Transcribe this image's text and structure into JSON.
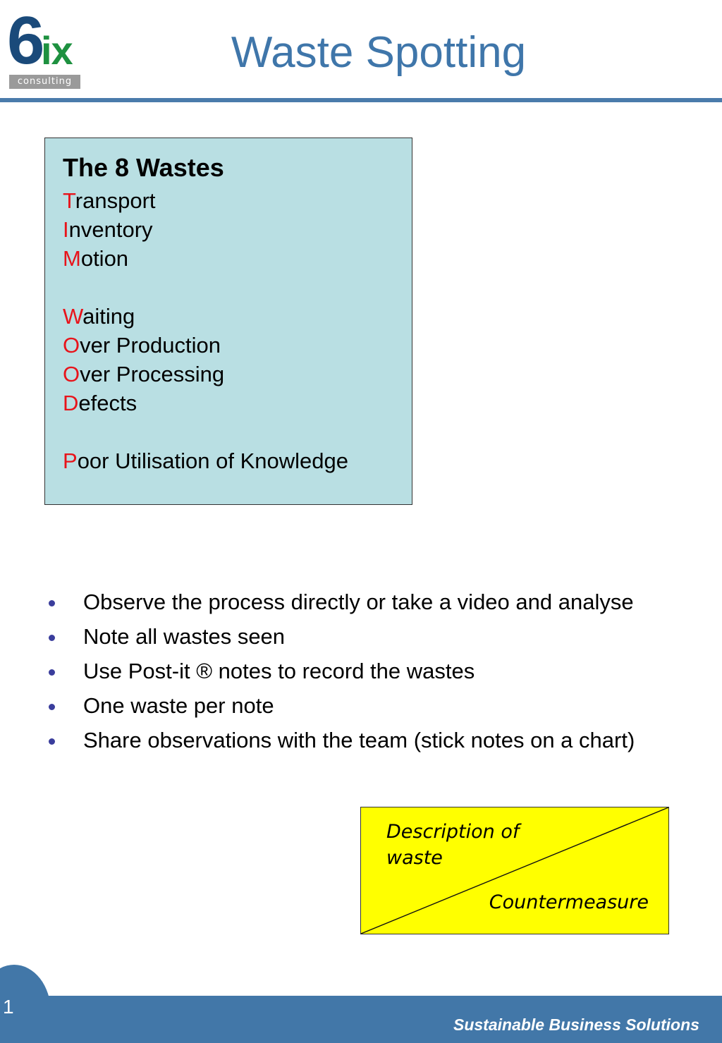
{
  "logo": {
    "numeral": "6",
    "letters": "ix",
    "tagline": "consulting"
  },
  "header": {
    "title": "Waste Spotting"
  },
  "wastes_box": {
    "title": "The 8 Wastes",
    "groups": [
      [
        {
          "initial": "T",
          "rest": "ransport"
        },
        {
          "initial": "I",
          "rest": "nventory"
        },
        {
          "initial": "M",
          "rest": "otion"
        }
      ],
      [
        {
          "initial": "W",
          "rest": "aiting"
        },
        {
          "initial": "O",
          "rest": "ver Production"
        },
        {
          "initial": "O",
          "rest": "ver Processing"
        },
        {
          "initial": "D",
          "rest": "efects"
        }
      ],
      [
        {
          "initial": "P",
          "rest": "oor Utilisation of Knowledge"
        }
      ]
    ]
  },
  "bullets": [
    "Observe the process directly or take a video and analyse",
    "Note all wastes seen",
    "Use Post-it ® notes to record the wastes",
    "One waste per note",
    "Share observations with the team (stick notes on a chart)"
  ],
  "postit": {
    "top_left_text": "Description of waste",
    "bottom_right_text": "Countermeasure"
  },
  "footer": {
    "page_number": "1",
    "tagline": "Sustainable Business Solutions"
  },
  "colors": {
    "brand_blue": "#4277a8",
    "title_blue": "#3f76aa",
    "highlight_red": "#e8141b",
    "box_teal": "#b9dfe3",
    "postit_yellow": "#ffff00",
    "bullet_dot": "#3a3d9c"
  }
}
